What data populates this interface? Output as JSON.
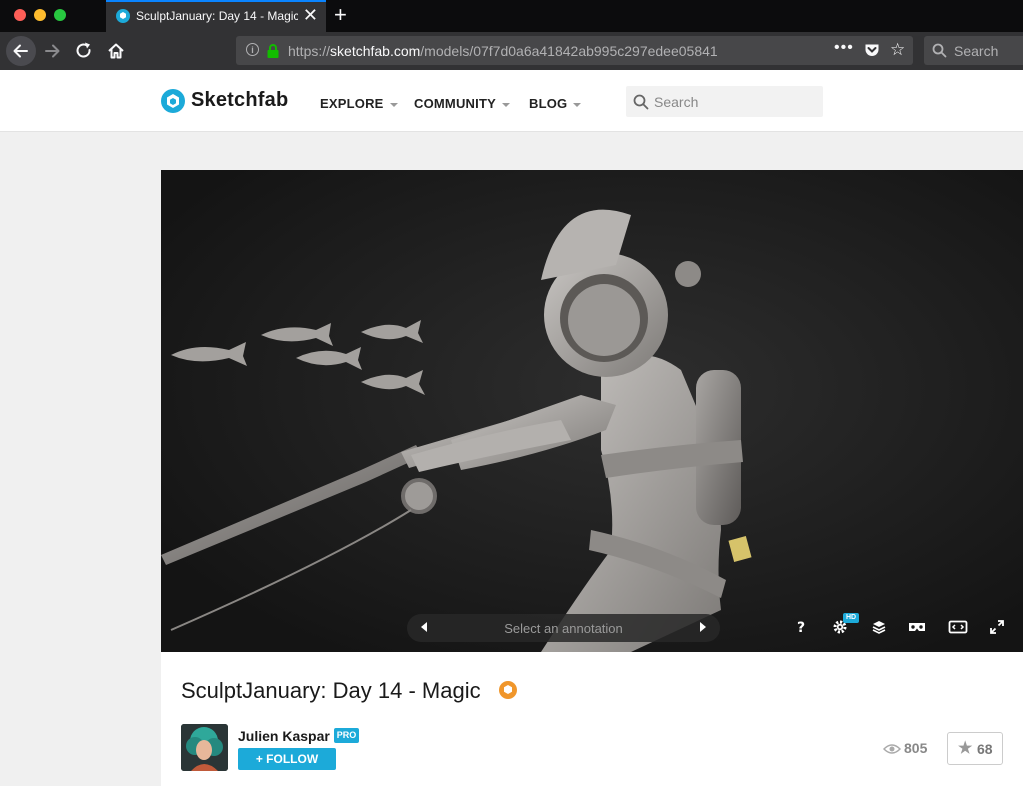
{
  "browser": {
    "tab_title": "SculptJanuary: Day 14 - Magic",
    "tab_close": "✕",
    "new_tab": "+",
    "url_scheme": "https://",
    "url_host": "sketchfab.com",
    "url_path": "/models/07f7d0a6a41842ab995c297edee05841",
    "search_placeholder": "Search",
    "page_actions": "•••",
    "star": "☆"
  },
  "site": {
    "brand": "Sketchfab",
    "nav": [
      {
        "label": "EXPLORE"
      },
      {
        "label": "COMMUNITY"
      },
      {
        "label": "BLOG"
      }
    ],
    "search_placeholder": "Search"
  },
  "viewer": {
    "annotation_placeholder": "Select an annotation",
    "hd_label": "HD",
    "controls": [
      "help-icon",
      "settings-icon",
      "layers-icon",
      "vr-icon",
      "resize-icon",
      "fullscreen-icon"
    ]
  },
  "model": {
    "title": "SculptJanuary: Day 14 - Magic",
    "author": "Julien Kaspar",
    "pro_label": "PRO",
    "follow_label": "+ FOLLOW",
    "views": "805",
    "likes": "68"
  },
  "colors": {
    "accent": "#1caad9",
    "staff_pick": "#f0962b",
    "viewer_bg": "#191919"
  }
}
